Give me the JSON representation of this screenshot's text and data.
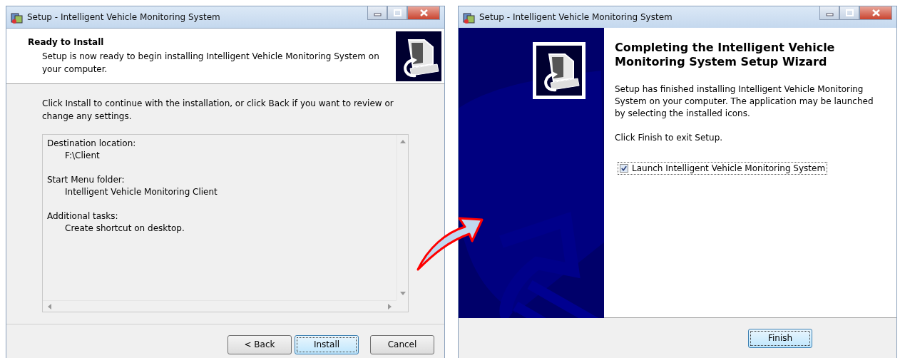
{
  "windows": [
    {
      "title": "Setup - Intelligent Vehicle Monitoring System",
      "kind": "ready",
      "header": {
        "title": "Ready to Install",
        "subtitle": "Setup is now ready to begin installing Intelligent Vehicle Monitoring System on your computer."
      },
      "intro": "Click Install to continue with the installation, or click Back if you want to review or change any settings.",
      "summary": [
        {
          "heading": "Destination location:",
          "value": "F:\\Client"
        },
        {
          "heading": "Start Menu folder:",
          "value": "Intelligent Vehicle Monitoring Client"
        },
        {
          "heading": "Additional tasks:",
          "value": "Create shortcut on desktop."
        }
      ],
      "buttons": [
        {
          "label": "< Back",
          "default": false
        },
        {
          "label": "Install",
          "default": true
        },
        {
          "label": "Cancel",
          "default": false
        }
      ]
    },
    {
      "title": "Setup - Intelligent Vehicle Monitoring System",
      "kind": "finish",
      "heading": "Completing the Intelligent Vehicle Monitoring System Setup Wizard",
      "paragraphs": [
        "Setup has finished installing Intelligent Vehicle Monitoring System on your computer. The application may be launched by selecting the installed icons.",
        "Click Finish to exit Setup."
      ],
      "checkbox": {
        "label": "Launch Intelligent Vehicle Monitoring System",
        "checked": true
      },
      "buttons": [
        {
          "label": "Finish",
          "default": true
        }
      ]
    }
  ]
}
